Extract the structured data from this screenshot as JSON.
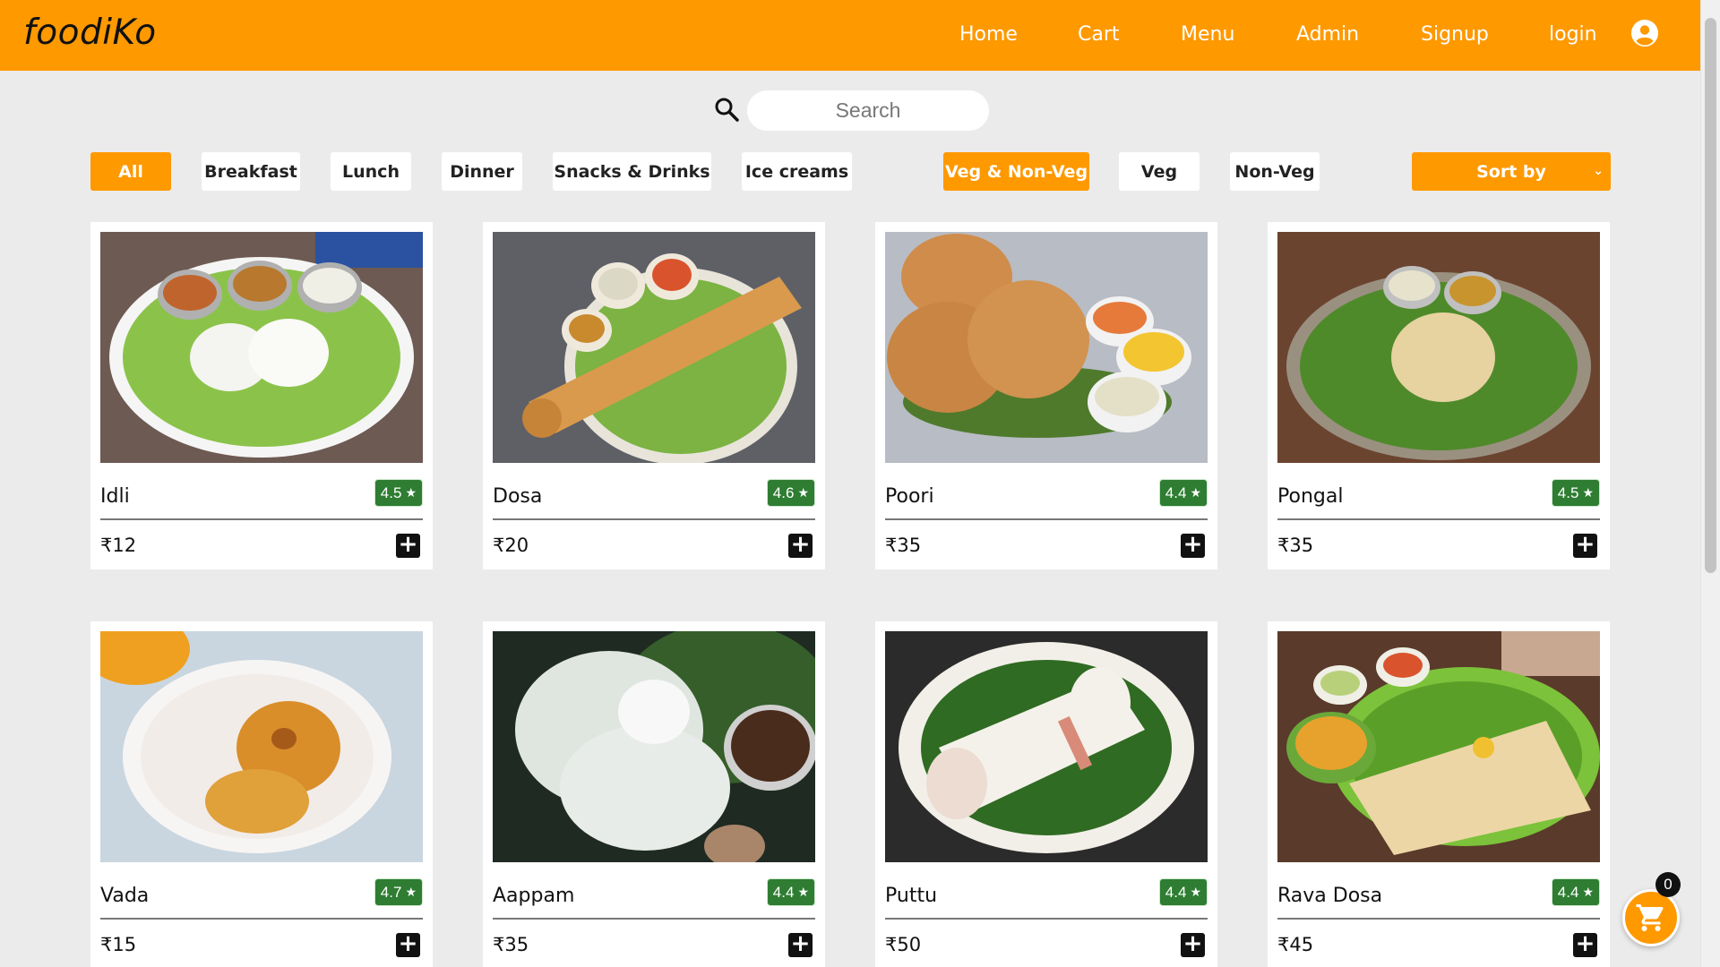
{
  "brand": "foodiKo",
  "nav": [
    {
      "label": "Home",
      "name": "nav-home"
    },
    {
      "label": "Cart",
      "name": "nav-cart"
    },
    {
      "label": "Menu",
      "name": "nav-menu"
    },
    {
      "label": "Admin",
      "name": "nav-admin"
    },
    {
      "label": "Signup",
      "name": "nav-signup"
    },
    {
      "label": "login",
      "name": "nav-login"
    }
  ],
  "search": {
    "placeholder": "Search",
    "value": ""
  },
  "categories": [
    "All",
    "Breakfast",
    "Lunch",
    "Dinner",
    "Snacks & Drinks",
    "Ice creams"
  ],
  "active_category": "All",
  "diet_filters": [
    "Veg & Non-Veg",
    "Veg",
    "Non-Veg"
  ],
  "active_diet": "Veg & Non-Veg",
  "sort": {
    "label": "Sort by"
  },
  "currency": "₹",
  "items": [
    {
      "name": "Idli",
      "rating": "4.5",
      "price": "₹12",
      "image_icon": "idli-image"
    },
    {
      "name": "Dosa",
      "rating": "4.6",
      "price": "₹20",
      "image_icon": "dosa-image"
    },
    {
      "name": "Poori",
      "rating": "4.4",
      "price": "₹35",
      "image_icon": "poori-image"
    },
    {
      "name": "Pongal",
      "rating": "4.5",
      "price": "₹35",
      "image_icon": "pongal-image"
    },
    {
      "name": "Vada",
      "rating": "4.7",
      "price": "₹15",
      "image_icon": "vada-image"
    },
    {
      "name": "Aappam",
      "rating": "4.4",
      "price": "₹35",
      "image_icon": "aappam-image"
    },
    {
      "name": "Puttu",
      "rating": "4.4",
      "price": "₹50",
      "image_icon": "puttu-image"
    },
    {
      "name": "Rava Dosa",
      "rating": "4.4",
      "price": "₹45",
      "image_icon": "rava-dosa-image"
    }
  ],
  "cart": {
    "count": "0"
  },
  "colors": {
    "brand_orange": "#ff9900",
    "rating_green": "#2e7d32",
    "background": "#ebebeb"
  },
  "icons": {
    "search": "search-icon",
    "profile": "account-circle-icon",
    "add": "plus-icon",
    "star": "star-icon",
    "cart": "shopping-cart-icon"
  }
}
